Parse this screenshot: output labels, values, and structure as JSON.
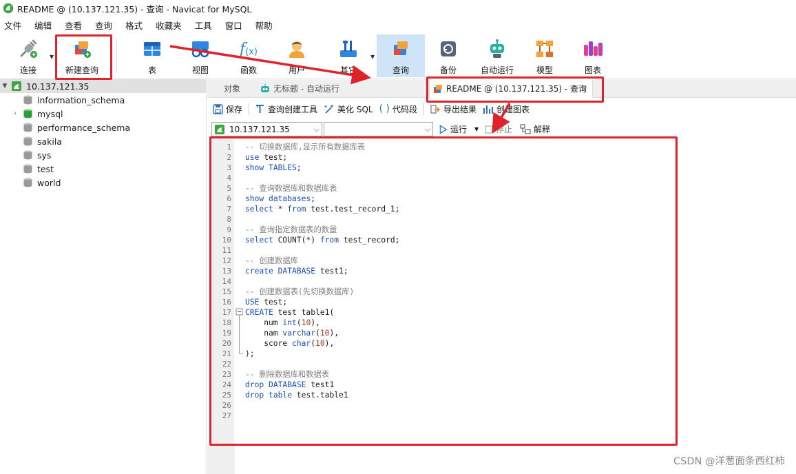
{
  "window": {
    "title": "README @ (10.137.121.35) - 查询 - Navicat for MySQL"
  },
  "menu": [
    "文件",
    "编辑",
    "查看",
    "查询",
    "格式",
    "收藏夹",
    "工具",
    "窗口",
    "帮助"
  ],
  "toolbar": {
    "connect": "连接",
    "new_query": "新建查询",
    "table": "表",
    "view": "视图",
    "function": "函数",
    "user": "用户",
    "other": "其它",
    "query": "查询",
    "backup": "备份",
    "auto_run": "自动运行",
    "model": "模型",
    "chart": "图表"
  },
  "sidebar": {
    "connection": "10.137.121.35",
    "databases": [
      "information_schema",
      "mysql",
      "performance_schema",
      "sakila",
      "sys",
      "test",
      "world"
    ]
  },
  "tabs": {
    "objects": "对象",
    "untitled": "无标题 - 自动运行",
    "active": "README @ (10.137.121.35) - 查询"
  },
  "query_toolbar": {
    "save": "保存",
    "query_builder": "查询创建工具",
    "beautify": "美化 SQL",
    "snippet": "代码段",
    "export": "导出结果",
    "create_chart": "创建图表"
  },
  "run_bar": {
    "connection_value": "10.137.121.35",
    "database_value": "",
    "run": "运行",
    "stop": "停止",
    "explain": "解释"
  },
  "editor": {
    "lines": [
      [
        [
          "comment",
          "-- 切换数据库,显示所有数据库表"
        ]
      ],
      [
        [
          "kw",
          "use"
        ],
        [
          "plain",
          " test;"
        ]
      ],
      [
        [
          "kw",
          "show"
        ],
        [
          "plain",
          " "
        ],
        [
          "kw",
          "TABLES"
        ],
        [
          "plain",
          ";"
        ]
      ],
      [],
      [
        [
          "comment",
          "-- 查询数据库和数据库表"
        ]
      ],
      [
        [
          "kw",
          "show"
        ],
        [
          "plain",
          " "
        ],
        [
          "kw",
          "databases"
        ],
        [
          "plain",
          ";"
        ]
      ],
      [
        [
          "kw",
          "select"
        ],
        [
          "plain",
          " * "
        ],
        [
          "kw",
          "from"
        ],
        [
          "plain",
          " test.test_record_1;"
        ]
      ],
      [],
      [
        [
          "comment",
          "-- 查询指定数据表的数量"
        ]
      ],
      [
        [
          "kw",
          "select"
        ],
        [
          "plain",
          " COUNT(*) "
        ],
        [
          "kw",
          "from"
        ],
        [
          "plain",
          " test_record;"
        ]
      ],
      [],
      [
        [
          "comment",
          "-- 创建数据库"
        ]
      ],
      [
        [
          "kw",
          "create"
        ],
        [
          "plain",
          " "
        ],
        [
          "kw",
          "DATABASE"
        ],
        [
          "plain",
          " test1;"
        ]
      ],
      [],
      [
        [
          "comment",
          "-- 创建数据表(先切换数据库)"
        ]
      ],
      [
        [
          "kw",
          "USE"
        ],
        [
          "plain",
          " test;"
        ]
      ],
      [
        [
          "kw",
          "CREATE"
        ],
        [
          "plain",
          " test table1("
        ]
      ],
      [
        [
          "plain",
          "    num "
        ],
        [
          "kw",
          "int"
        ],
        [
          "plain",
          "("
        ],
        [
          "num",
          "10"
        ],
        [
          "plain",
          "),"
        ]
      ],
      [
        [
          "plain",
          "    nam "
        ],
        [
          "kw",
          "varchar"
        ],
        [
          "plain",
          "("
        ],
        [
          "num",
          "10"
        ],
        [
          "plain",
          "),"
        ]
      ],
      [
        [
          "plain",
          "    score "
        ],
        [
          "kw",
          "char"
        ],
        [
          "plain",
          "("
        ],
        [
          "num",
          "10"
        ],
        [
          "plain",
          "),"
        ]
      ],
      [
        [
          "plain",
          ");"
        ]
      ],
      [],
      [
        [
          "comment",
          "-- 删除数据库和数据表"
        ]
      ],
      [
        [
          "kw",
          "drop"
        ],
        [
          "plain",
          " "
        ],
        [
          "kw",
          "DATABASE"
        ],
        [
          "plain",
          " test1"
        ]
      ],
      [
        [
          "kw",
          "drop"
        ],
        [
          "plain",
          " "
        ],
        [
          "kw",
          "table"
        ],
        [
          "plain",
          " test.table1"
        ]
      ],
      [],
      []
    ]
  },
  "watermark": "CSDN @洋葱面条西红柿",
  "colors": {
    "annotation_red": "#e0222b",
    "active_tool_bg": "#cfe4f7",
    "keyword_blue": "#1a4fbf",
    "comment_gray": "#808080"
  }
}
